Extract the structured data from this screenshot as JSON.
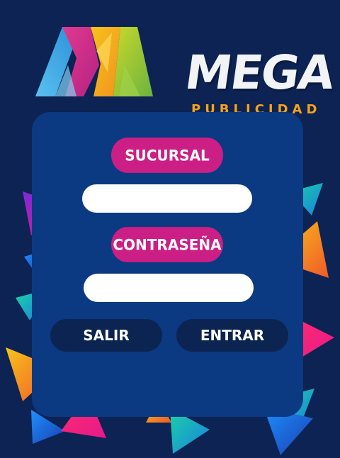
{
  "brand": {
    "name": "MEGA",
    "tagline": "PUBLICIDAD",
    "colors": {
      "accent": "#cc1f85",
      "orange": "#f5a21a",
      "background": "#0c2354",
      "panel": "#0b3a82"
    }
  },
  "form": {
    "branch_label": "SUCURSAL",
    "branch_value": "",
    "password_label": "CONTRASEÑA",
    "password_value": "",
    "exit_label": "SALIR",
    "enter_label": "ENTRAR"
  }
}
